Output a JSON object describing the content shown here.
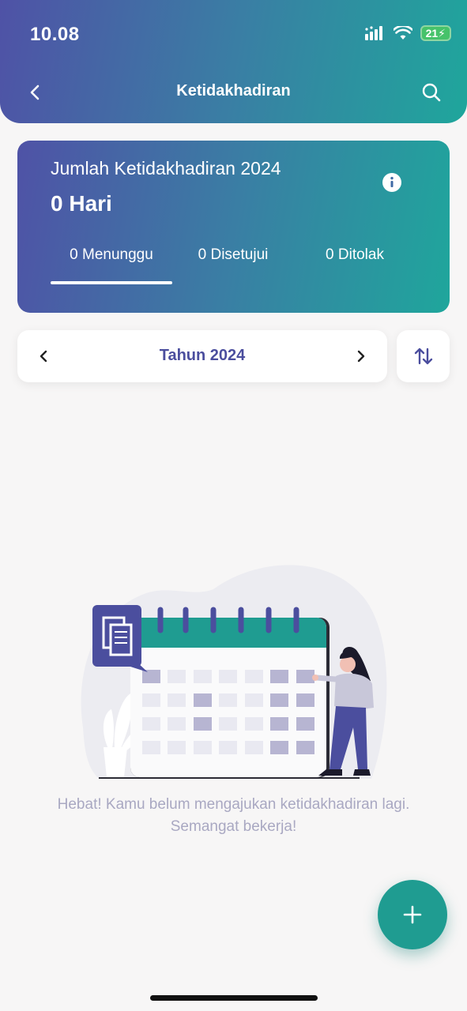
{
  "status_bar": {
    "time": "10.08",
    "battery": "21"
  },
  "header": {
    "title": "Ketidakhadiran"
  },
  "summary": {
    "title": "Jumlah Ketidakhadiran 2024",
    "value": "0 Hari",
    "tabs": [
      {
        "label": "0 Menunggu",
        "active": true
      },
      {
        "label": "0 Disetujui",
        "active": false
      },
      {
        "label": "0 Ditolak",
        "active": false
      }
    ]
  },
  "year_filter": {
    "label": "Tahun 2024"
  },
  "empty_state": {
    "line1": "Hebat! Kamu belum mengajukan ketidakhadiran lagi.",
    "line2": "Semangat bekerja!"
  },
  "colors": {
    "gradient_start": "#4f52a6",
    "gradient_end": "#1fa69c",
    "accent": "#4b4e9e",
    "fab": "#1f9c91"
  },
  "icons": {
    "back": "chevron-left-icon",
    "search": "search-icon",
    "info": "info-icon",
    "prev": "chevron-left-icon",
    "next": "chevron-right-icon",
    "sort": "sort-icon",
    "add": "plus-icon"
  }
}
